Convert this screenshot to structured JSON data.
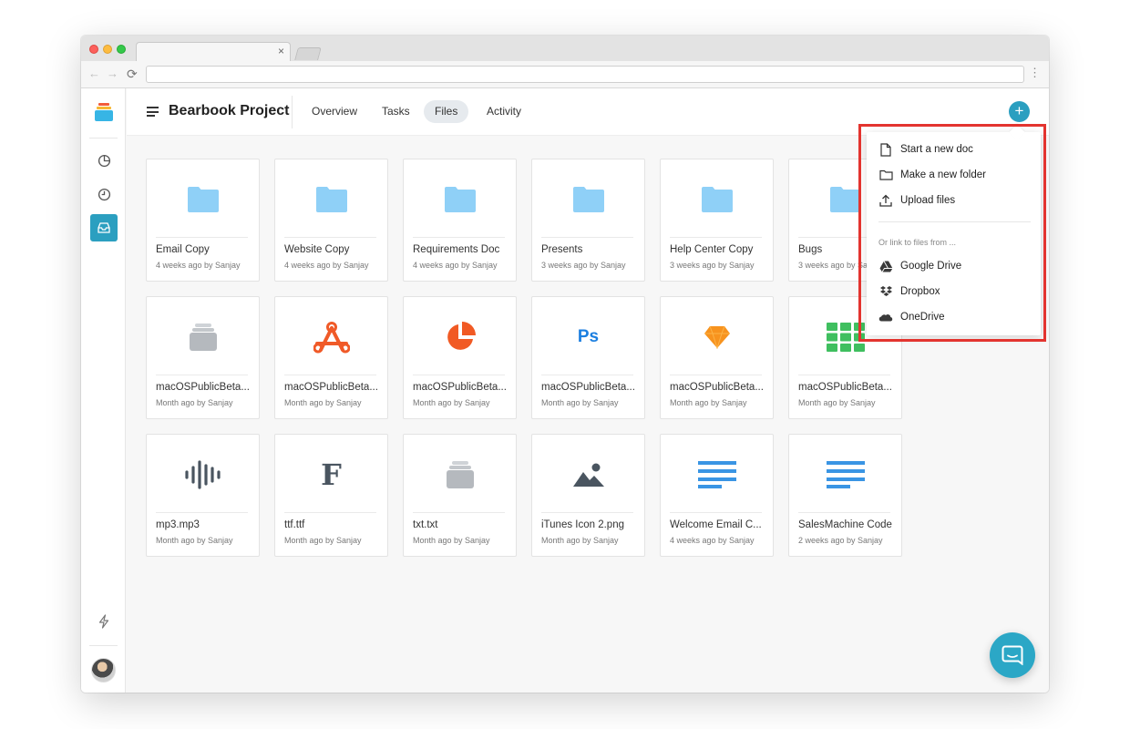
{
  "browser": {
    "tab_close": "×",
    "back": "←",
    "forward": "→",
    "reload": "⟳",
    "menu": "⋮",
    "url": ""
  },
  "sidebar": {
    "icons": [
      "reports-icon",
      "clock-icon",
      "inbox-icon"
    ],
    "active": "inbox-icon",
    "bottom_icon": "lightning-icon"
  },
  "header": {
    "title": "Bearbook Project",
    "tabs": [
      {
        "label": "Overview"
      },
      {
        "label": "Tasks"
      },
      {
        "label": "Files",
        "active": true
      },
      {
        "label": "Activity"
      }
    ],
    "add_label": "+"
  },
  "files": [
    {
      "name": "Email Copy",
      "meta": "4 weeks ago by Sanjay",
      "icon": "folder-icon"
    },
    {
      "name": "Website Copy",
      "meta": "4 weeks ago by Sanjay",
      "icon": "folder-icon"
    },
    {
      "name": "Requirements Doc",
      "meta": "4 weeks ago by Sanjay",
      "icon": "folder-icon"
    },
    {
      "name": "Presents",
      "meta": "3 weeks ago by Sanjay",
      "icon": "folder-icon"
    },
    {
      "name": "Help Center Copy",
      "meta": "3 weeks ago by Sanjay",
      "icon": "folder-icon"
    },
    {
      "name": "Bugs",
      "meta": "3 weeks ago by Sanjay",
      "icon": "folder-icon"
    },
    {
      "name": "macOSPublicBeta...",
      "meta": "Month ago by Sanjay",
      "icon": "archive-icon"
    },
    {
      "name": "macOSPublicBeta...",
      "meta": "Month ago by Sanjay",
      "icon": "pdf-icon"
    },
    {
      "name": "macOSPublicBeta...",
      "meta": "Month ago by Sanjay",
      "icon": "pie-chart-icon"
    },
    {
      "name": "macOSPublicBeta...",
      "meta": "Month ago by Sanjay",
      "icon": "photoshop-icon",
      "icon_text": "Ps"
    },
    {
      "name": "macOSPublicBeta...",
      "meta": "Month ago by Sanjay",
      "icon": "sketch-icon"
    },
    {
      "name": "macOSPublicBeta...",
      "meta": "Month ago by Sanjay",
      "icon": "spreadsheet-icon"
    },
    {
      "name": "mp3.mp3",
      "meta": "Month ago by Sanjay",
      "icon": "audio-icon"
    },
    {
      "name": "ttf.ttf",
      "meta": "Month ago by Sanjay",
      "icon": "font-icon",
      "icon_text": "F"
    },
    {
      "name": "txt.txt",
      "meta": "Month ago by Sanjay",
      "icon": "archive-icon"
    },
    {
      "name": "iTunes Icon 2.png",
      "meta": "Month ago by Sanjay",
      "icon": "image-icon"
    },
    {
      "name": "Welcome Email C...",
      "meta": "4 weeks ago by Sanjay",
      "icon": "document-icon"
    },
    {
      "name": "SalesMachine Code",
      "meta": "2 weeks ago by Sanjay",
      "icon": "document-icon"
    }
  ],
  "dropdown": {
    "create_items": [
      {
        "label": "Start a new doc",
        "icon": "new-doc-icon"
      },
      {
        "label": "Make a new folder",
        "icon": "new-folder-icon"
      },
      {
        "label": "Upload files",
        "icon": "upload-icon"
      }
    ],
    "caption": "Or link to files from ...",
    "link_items": [
      {
        "label": "Google Drive",
        "icon": "google-drive-icon"
      },
      {
        "label": "Dropbox",
        "icon": "dropbox-icon"
      },
      {
        "label": "OneDrive",
        "icon": "onedrive-icon"
      }
    ]
  },
  "colors": {
    "accent": "#2b9fc0",
    "folder": "#8fd0f7",
    "highlight": "#e3342f"
  }
}
